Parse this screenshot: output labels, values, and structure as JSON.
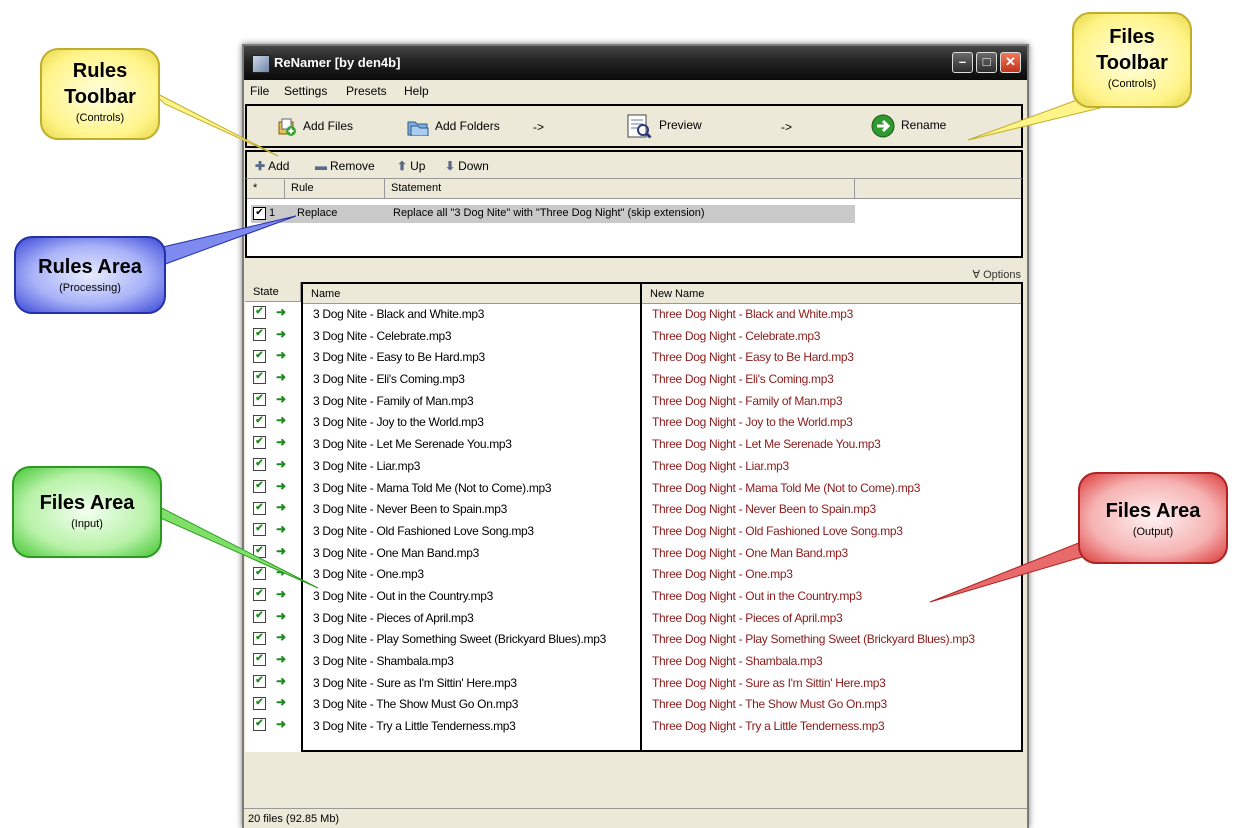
{
  "window": {
    "title": "ReNamer  [by den4b]"
  },
  "menu": [
    "File",
    "Settings",
    "Presets",
    "Help"
  ],
  "files_toolbar": {
    "add_files": "Add Files",
    "add_folders": "Add Folders",
    "arrow1": "->",
    "preview": "Preview",
    "arrow2": "->",
    "rename": "Rename"
  },
  "rules_toolbar": {
    "add": "Add",
    "remove": "Remove",
    "up": "Up",
    "down": "Down"
  },
  "rules_table": {
    "headers": {
      "marker": "*",
      "rule": "Rule",
      "statement": "Statement"
    },
    "rows": [
      {
        "index": "1",
        "rule": "Replace",
        "statement": "Replace all \"3 Dog Nite\" with \"Three Dog Night\" (skip extension)"
      }
    ]
  },
  "options_label": "Options",
  "files_table": {
    "headers": {
      "state": "State",
      "name": "Name",
      "new_name": "New Name"
    },
    "names": [
      "3 Dog Nite - Black and White.mp3",
      "3 Dog Nite - Celebrate.mp3",
      "3 Dog Nite - Easy to Be Hard.mp3",
      "3 Dog Nite - Eli's Coming.mp3",
      "3 Dog Nite - Family of Man.mp3",
      "3 Dog Nite - Joy to the World.mp3",
      "3 Dog Nite - Let Me Serenade You.mp3",
      "3 Dog Nite - Liar.mp3",
      "3 Dog Nite - Mama Told Me (Not to Come).mp3",
      "3 Dog Nite - Never Been to Spain.mp3",
      "3 Dog Nite - Old Fashioned Love Song.mp3",
      "3 Dog Nite - One Man Band.mp3",
      "3 Dog Nite - One.mp3",
      "3 Dog Nite - Out in the Country.mp3",
      "3 Dog Nite - Pieces of April.mp3",
      "3 Dog Nite - Play Something Sweet (Brickyard Blues).mp3",
      "3 Dog Nite - Shambala.mp3",
      "3 Dog Nite - Sure as I'm Sittin' Here.mp3",
      "3 Dog Nite - The Show Must Go On.mp3",
      "3 Dog Nite - Try a Little Tenderness.mp3"
    ],
    "new_names": [
      "Three Dog Night - Black and White.mp3",
      "Three Dog Night - Celebrate.mp3",
      "Three Dog Night - Easy to Be Hard.mp3",
      "Three Dog Night - Eli's Coming.mp3",
      "Three Dog Night - Family of Man.mp3",
      "Three Dog Night - Joy to the World.mp3",
      "Three Dog Night - Let Me Serenade You.mp3",
      "Three Dog Night - Liar.mp3",
      "Three Dog Night - Mama Told Me (Not to Come).mp3",
      "Three Dog Night - Never Been to Spain.mp3",
      "Three Dog Night - Old Fashioned Love Song.mp3",
      "Three Dog Night - One Man Band.mp3",
      "Three Dog Night - One.mp3",
      "Three Dog Night - Out in the Country.mp3",
      "Three Dog Night - Pieces of April.mp3",
      "Three Dog Night - Play Something Sweet (Brickyard Blues).mp3",
      "Three Dog Night - Shambala.mp3",
      "Three Dog Night - Sure as I'm Sittin' Here.mp3",
      "Three Dog Night - The Show Must Go On.mp3",
      "Three Dog Night - Try a Little Tenderness.mp3"
    ]
  },
  "status": "20 files (92.85 Mb)",
  "callouts": {
    "rules_toolbar": {
      "title": "Rules Toolbar",
      "sub": "(Controls)"
    },
    "files_toolbar": {
      "title": "Files Toolbar",
      "sub": "(Controls)"
    },
    "rules_area": {
      "title": "Rules Area",
      "sub": "(Processing)"
    },
    "files_input": {
      "title": "Files Area",
      "sub": "(Input)"
    },
    "files_output": {
      "title": "Files Area",
      "sub": "(Output)"
    }
  },
  "colors": {
    "new_name_text": "#8b1a1a",
    "state_arrow": "#1c8c1c"
  }
}
